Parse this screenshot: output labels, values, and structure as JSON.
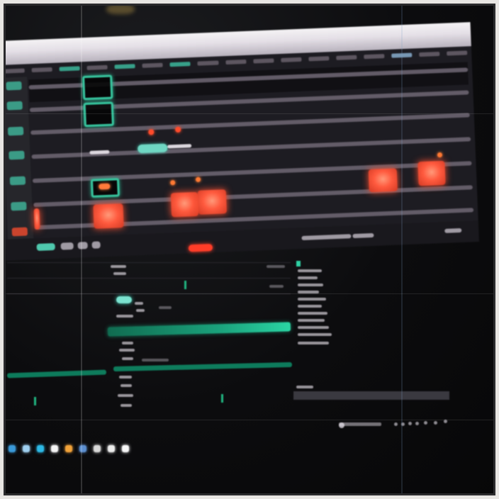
{
  "app": {
    "title": ""
  },
  "colors": {
    "clip_red": "#ff5a3e",
    "clip_outline": "#37c59e",
    "accent_green": "#1aa17b",
    "lane": "#6c6470",
    "background": "#1d1c22"
  },
  "timeline": {
    "tracks": [
      "",
      "",
      "",
      "",
      "",
      ""
    ],
    "clip_states": [
      "outlined",
      "outlined",
      "outlined",
      "filled",
      "filled",
      "filled",
      "filled",
      "filled"
    ]
  },
  "icons": [
    "record-dot-icon",
    "record-dot-icon",
    "marker-icon",
    "marker-icon",
    "marker-icon",
    "play-icon",
    "settings-icon"
  ],
  "lower_panel": {
    "inspector_rows": [
      "",
      "",
      "",
      "",
      "",
      "",
      "",
      "",
      ""
    ],
    "list_rows": [
      "",
      "",
      "",
      "",
      "",
      "",
      "",
      "",
      "",
      "",
      ""
    ]
  },
  "dock": {
    "apps": [
      {
        "color": "#3a9ad9"
      },
      {
        "color": "#9fd0f0"
      },
      {
        "color": "#2db9e6"
      },
      {
        "color": "#f4f4f4"
      },
      {
        "color": "#f2a33a"
      },
      {
        "color": "#5c8fd0"
      },
      {
        "color": "#d8d8d8"
      },
      {
        "color": "#ececec"
      },
      {
        "color": "#f6f6f6"
      }
    ]
  }
}
